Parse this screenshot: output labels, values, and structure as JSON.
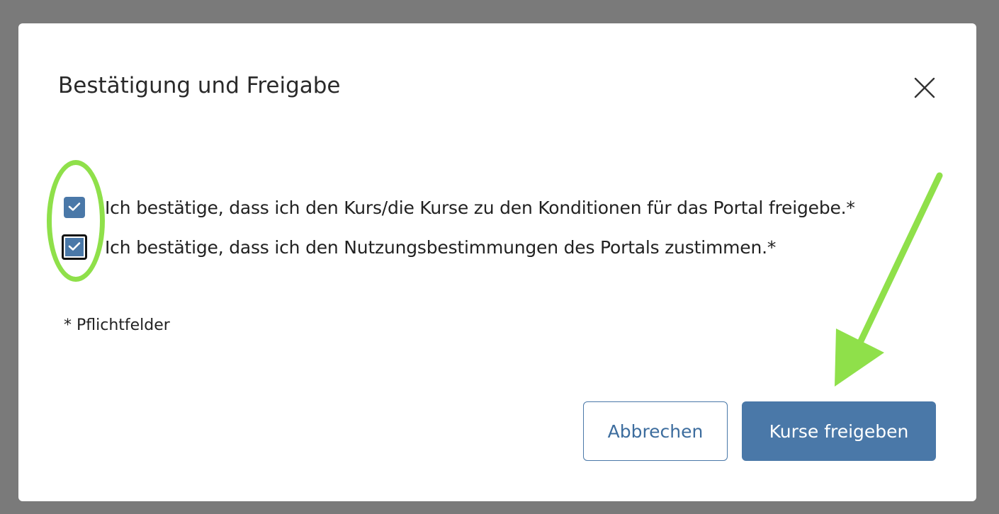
{
  "dialog": {
    "title": "Bestätigung und Freigabe",
    "close_icon": "close-icon",
    "checkboxes": [
      {
        "label": "Ich bestätige, dass ich den Kurs/die Kurse zu den Konditionen für das Portal freigebe.*",
        "checked": true,
        "focused": false
      },
      {
        "label": "Ich bestätige, dass ich den Nutzungsbestimmungen des Portals zustimmen.*",
        "checked": true,
        "focused": true
      }
    ],
    "required_note": "* Pflichtfelder",
    "cancel_label": "Abbrechen",
    "submit_label": "Kurse freigeben"
  },
  "colors": {
    "primary": "#4a78a8",
    "backdrop": "#7a7a7a",
    "annotation": "#8fe04a"
  }
}
